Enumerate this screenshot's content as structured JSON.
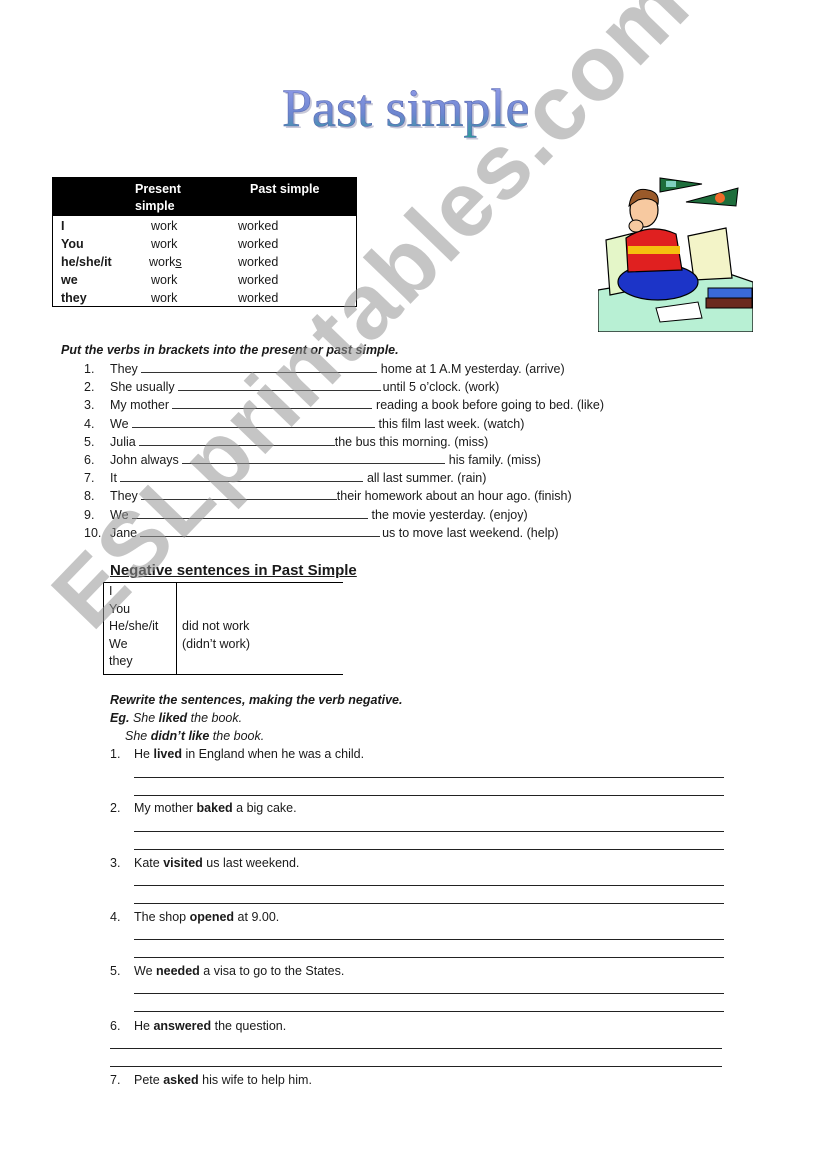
{
  "title": "Past simple",
  "conjugation_table": {
    "headers": [
      "",
      "Present simple",
      "Past simple"
    ],
    "header_present_lines": [
      "Present",
      "simple"
    ],
    "rows": [
      {
        "pronoun": "I",
        "present": "work",
        "past": "worked"
      },
      {
        "pronoun": "You",
        "present": "work",
        "past": "worked"
      },
      {
        "pronoun": "he/she/it",
        "present": "works",
        "past": "worked"
      },
      {
        "pronoun": "we",
        "present": "work",
        "past": "worked"
      },
      {
        "pronoun": "they",
        "present": "work",
        "past": "worked"
      }
    ]
  },
  "picture": {
    "description": "clipart of a boy sitting cross-legged on a bed doing homework, with pennants on the wall"
  },
  "exercise1": {
    "instruction": "Put the verbs in brackets into the present or past simple.",
    "items": [
      {
        "num": "1.",
        "before": "They",
        "after": "home at 1 A.M yesterday. (arrive)"
      },
      {
        "num": "2.",
        "before": "She usually",
        "after": "until 5 o’clock. (work)"
      },
      {
        "num": "3.",
        "before": "My mother",
        "after": "reading a book before going to bed. (like)"
      },
      {
        "num": "4.",
        "before": "We",
        "after": "this film last week. (watch)"
      },
      {
        "num": "5.",
        "before": "Julia",
        "after": "the bus this morning. (miss)"
      },
      {
        "num": "6.",
        "before": "John always",
        "after": "his family. (miss)"
      },
      {
        "num": "7.",
        "before": "It",
        "after": "all last summer. (rain)"
      },
      {
        "num": "8.",
        "before": "They",
        "after": "their homework about an hour ago. (finish)"
      },
      {
        "num": "9.",
        "before": "We",
        "after": "the movie yesterday. (enjoy)"
      },
      {
        "num": "10.",
        "before": "Jane",
        "after": "us to move last weekend. (help)"
      }
    ]
  },
  "negative_table": {
    "title": "Negative sentences in Past Simple",
    "pronouns": [
      "I",
      "You",
      "He/she/it",
      "We",
      "they"
    ],
    "verb_lines": [
      "did not work",
      "(didn’t work)"
    ]
  },
  "exercise2": {
    "instruction": "Rewrite the sentences, making the verb negative.",
    "example_label": "Eg.",
    "example": {
      "pre": "She",
      "bold": "liked",
      "post": "the book."
    },
    "example_answer": {
      "pre": "She",
      "bold": "didn’t like",
      "post": "the book."
    },
    "items": [
      {
        "num": "1.",
        "pre": "He",
        "bold": "lived",
        "post": "in England when he was a child."
      },
      {
        "num": "2.",
        "pre": "My mother",
        "bold": "baked",
        "post": "a big cake."
      },
      {
        "num": "3.",
        "pre": "Kate",
        "bold": "visited",
        "post": "us last weekend."
      },
      {
        "num": "4.",
        "pre": "The shop",
        "bold": "opened",
        "post": "at 9.00."
      },
      {
        "num": "5.",
        "pre": "We",
        "bold": "needed",
        "post": "a visa to go to the States."
      },
      {
        "num": "6.",
        "pre": "He",
        "bold": "answered",
        "post": "the question."
      },
      {
        "num": "7.",
        "pre": "Pete",
        "bold": "asked",
        "post": "his wife to help him."
      }
    ]
  },
  "watermark": "ESLprintables.com",
  "colors": {
    "title_gradient_top": "#8a8fe0",
    "title_gradient_bottom": "#2f9a9a",
    "watermark": "#969696"
  }
}
